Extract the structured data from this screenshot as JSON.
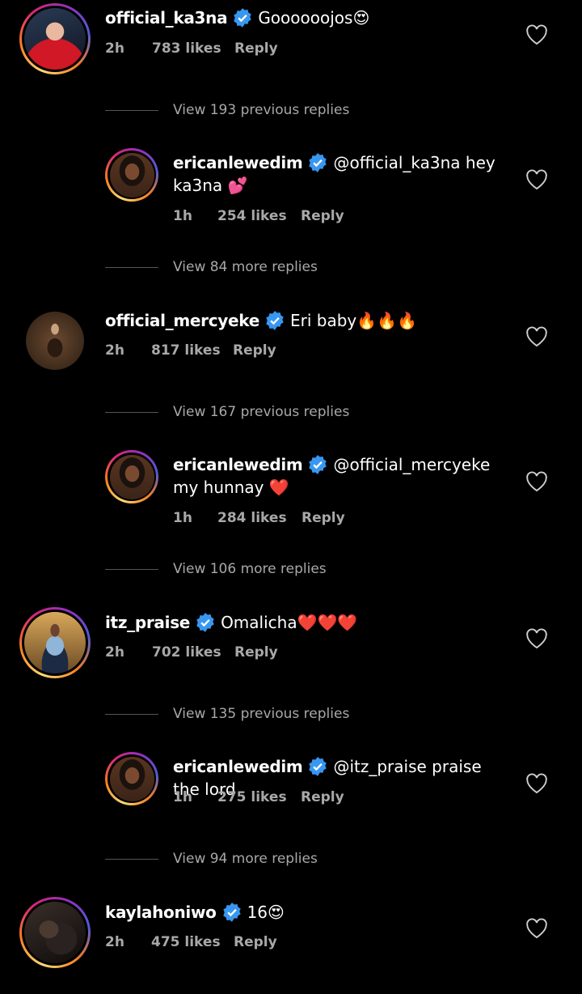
{
  "colors": {
    "background": "#000000",
    "muted": "#a8a8a8",
    "verified": "#3897f0"
  },
  "comments": [
    {
      "username": "official_ka3na",
      "text": "Goooooojos😍",
      "time": "2h",
      "likes": "783 likes",
      "reply": "Reply"
    },
    {
      "username": "ericanlewedim",
      "text": "@official_ka3na hey ka3na 💕",
      "time": "1h",
      "likes": "254 likes",
      "reply": "Reply"
    },
    {
      "username": "official_mercyeke",
      "text": "Eri baby🔥🔥🔥",
      "time": "2h",
      "likes": "817 likes",
      "reply": "Reply"
    },
    {
      "username": "ericanlewedim",
      "text": "@official_mercyeke my hunnay ❤️",
      "time": "1h",
      "likes": "284 likes",
      "reply": "Reply"
    },
    {
      "username": "itz_praise",
      "text": "Omalicha❤️❤️❤️",
      "time": "2h",
      "likes": "702 likes",
      "reply": "Reply"
    },
    {
      "username": "ericanlewedim",
      "text": "@itz_praise praise the lord",
      "time": "1h",
      "likes": "275 likes",
      "reply": "Reply"
    },
    {
      "username": "kaylahoniwo",
      "text": "16😍",
      "time": "2h",
      "likes": "475 likes",
      "reply": "Reply"
    }
  ],
  "view_more": [
    "View 193 previous replies",
    "View 84 more replies",
    "View 167 previous replies",
    "View 106 more replies",
    "View 135 previous replies",
    "View 94 more replies"
  ],
  "icons": {
    "verified": "verified-badge-icon",
    "like": "heart-outline-icon"
  }
}
